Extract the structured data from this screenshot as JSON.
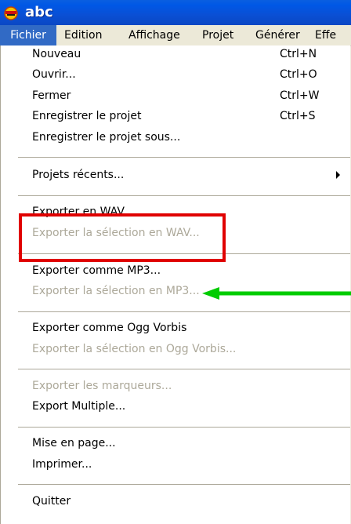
{
  "window": {
    "title": "abc"
  },
  "menubar": {
    "items": [
      {
        "label": "Fichier"
      },
      {
        "label": "Edition"
      },
      {
        "label": "Affichage"
      },
      {
        "label": "Projet"
      },
      {
        "label": "Générer"
      },
      {
        "label": "Effe"
      }
    ]
  },
  "file_menu": {
    "items": [
      {
        "label": "Nouveau",
        "shortcut": "Ctrl+N"
      },
      {
        "label": "Ouvrir...",
        "shortcut": "Ctrl+O"
      },
      {
        "label": "Fermer",
        "shortcut": "Ctrl+W"
      },
      {
        "label": "Enregistrer le projet",
        "shortcut": "Ctrl+S"
      },
      {
        "label": "Enregistrer le projet sous..."
      },
      {
        "label": "Projets récents..."
      },
      {
        "label": "Exporter en WAV..."
      },
      {
        "label": "Exporter la sélection en WAV..."
      },
      {
        "label": "Exporter comme MP3..."
      },
      {
        "label": "Exporter la sélection en MP3..."
      },
      {
        "label": "Exporter comme Ogg Vorbis"
      },
      {
        "label": "Exporter la sélection en Ogg Vorbis..."
      },
      {
        "label": "Exporter les marqueurs..."
      },
      {
        "label": "Export Multiple..."
      },
      {
        "label": "Mise en page..."
      },
      {
        "label": "Imprimer..."
      },
      {
        "label": "Quitter"
      }
    ]
  },
  "annotations": {
    "highlight_color": "#e00000",
    "arrow_color": "#00cc00"
  },
  "colors": {
    "titlebar": "#0a4fd4",
    "menu_selection": "#316ac5",
    "disabled_text": "#aca899"
  }
}
